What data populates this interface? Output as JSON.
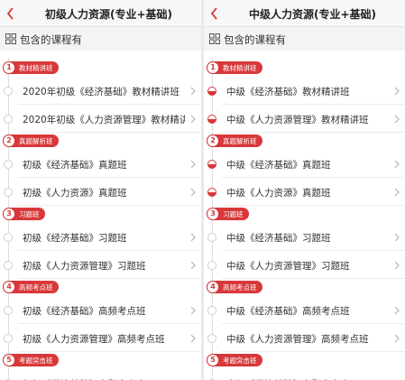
{
  "left": {
    "title": "初级人力资源(专业+基础)",
    "contains_label": "包含的课程有",
    "sections": [
      {
        "num": "1",
        "label": "教材精讲班",
        "courses": [
          {
            "name": "2020年初级《经济基础》教材精讲班",
            "progress": false
          },
          {
            "name": "2020年初级《人力资源管理》教材精讲...",
            "progress": false
          }
        ]
      },
      {
        "num": "2",
        "label": "真题解析班",
        "courses": [
          {
            "name": "初级《经济基础》真题班",
            "progress": false
          },
          {
            "name": "初级《人力资源》真题班",
            "progress": false
          }
        ]
      },
      {
        "num": "3",
        "label": "习题班",
        "courses": [
          {
            "name": "初级《经济基础》习题班",
            "progress": false
          },
          {
            "name": "初级《人力资源管理》习题班",
            "progress": false
          }
        ]
      },
      {
        "num": "4",
        "label": "高频考点班",
        "courses": [
          {
            "name": "初级《经济基础》高频考点班",
            "progress": false
          },
          {
            "name": "初级《人力资源管理》高频考点班",
            "progress": false
          }
        ]
      },
      {
        "num": "5",
        "label": "考题突击班",
        "courses": [
          {
            "name": "初级《经济基础》考题突击班",
            "progress": false
          }
        ]
      }
    ]
  },
  "right": {
    "title": "中级人力资源(专业+基础)",
    "contains_label": "包含的课程有",
    "sections": [
      {
        "num": "1",
        "label": "教材精讲班",
        "courses": [
          {
            "name": "中级《经济基础》教材精讲班",
            "progress": true
          },
          {
            "name": "中级《人力资源管理》教材精讲班",
            "progress": true
          }
        ]
      },
      {
        "num": "2",
        "label": "真题解析班",
        "courses": [
          {
            "name": "中级《经济基础》真题班",
            "progress": true
          },
          {
            "name": "中级《人力资源》真题班",
            "progress": true
          }
        ]
      },
      {
        "num": "3",
        "label": "习题班",
        "courses": [
          {
            "name": "中级《经济基础》习题班",
            "progress": false
          },
          {
            "name": "中级《人力资源管理》习题班",
            "progress": false
          }
        ]
      },
      {
        "num": "4",
        "label": "高频考点班",
        "courses": [
          {
            "name": "中级《经济基础》高频考点班",
            "progress": false
          },
          {
            "name": "中级《人力资源管理》高频考点班",
            "progress": false
          }
        ]
      },
      {
        "num": "5",
        "label": "考题突击班",
        "courses": [
          {
            "name": "中级《经济基础》考题突击班",
            "progress": false
          }
        ]
      }
    ]
  },
  "icons": {
    "back": "chevron-left-icon",
    "grid": "grid-icon",
    "chevron": "chevron-right-icon"
  },
  "colors": {
    "accent": "#d8383a",
    "header_bg": "#f7f7f7",
    "section_bar_bg": "#f4f4f4"
  }
}
